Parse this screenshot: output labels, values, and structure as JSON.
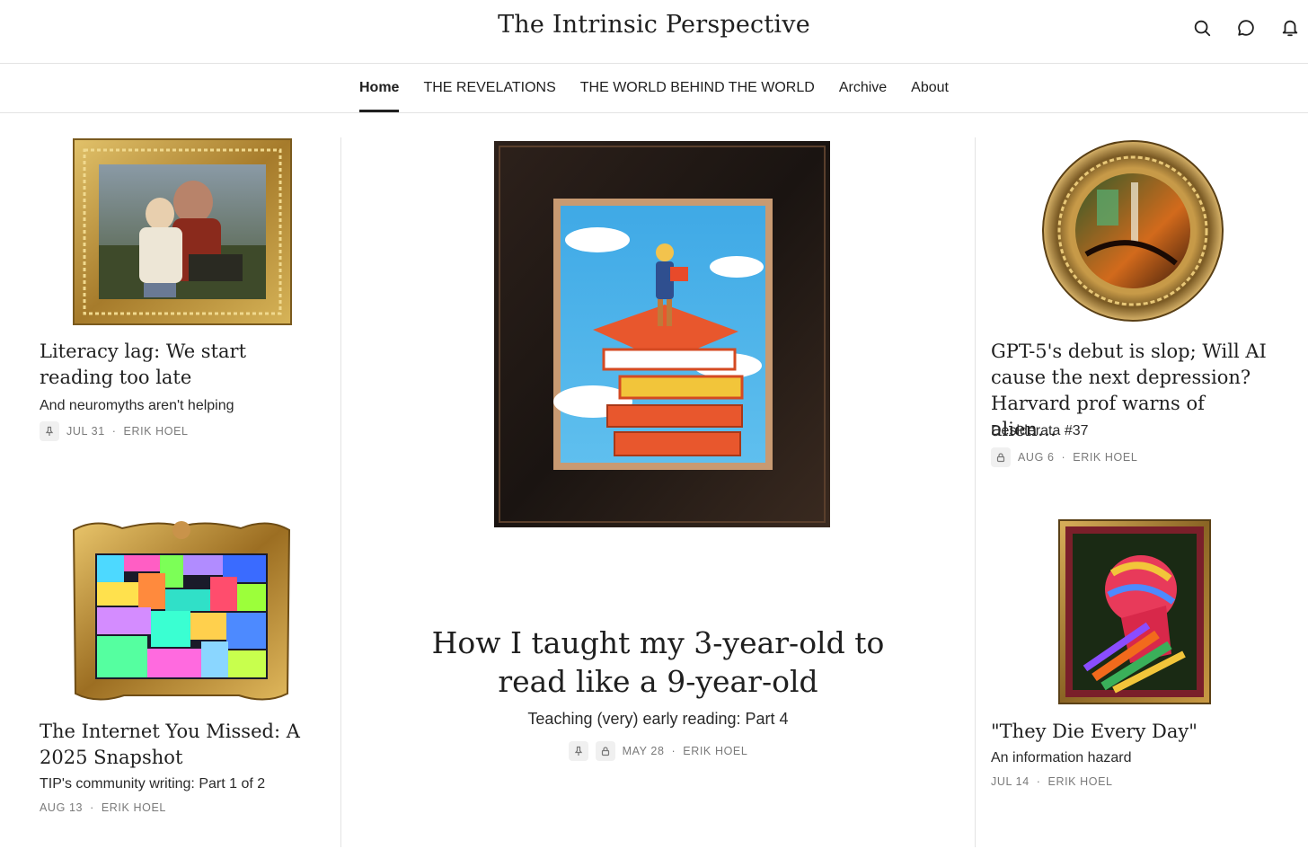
{
  "header": {
    "site_title": "The Intrinsic Perspective",
    "icons": [
      "search-icon",
      "chat-icon",
      "bell-icon"
    ]
  },
  "nav": {
    "items": [
      {
        "label": "Home",
        "active": true
      },
      {
        "label": "THE REVELATIONS",
        "active": false
      },
      {
        "label": "THE WORLD BEHIND THE WORLD",
        "active": false
      },
      {
        "label": "Archive",
        "active": false
      },
      {
        "label": "About",
        "active": false
      }
    ]
  },
  "posts": {
    "literacy": {
      "title": "Literacy lag: We start reading too late",
      "subtitle": "And neuromyths aren't helping",
      "date": "JUL 31",
      "author": "ERIK HOEL",
      "badges": [
        "pin-icon"
      ]
    },
    "internet": {
      "title": "The Internet You Missed: A 2025 Snapshot",
      "subtitle": "TIP's community writing: Part 1 of 2",
      "date": "AUG 13",
      "author": "ERIK HOEL",
      "badges": []
    },
    "featured": {
      "title": "How I taught my 3-year-old to read like a 9-year-old",
      "subtitle": "Teaching (very) early reading: Part 4",
      "date": "MAY 28",
      "author": "ERIK HOEL",
      "badges": [
        "pin-icon",
        "lock-icon"
      ]
    },
    "gpt5": {
      "title": "GPT-5's debut is slop; Will AI cause the next depression? Harvard prof warns of alien…",
      "subtitle": "Desiderata #37",
      "date": "AUG 6",
      "author": "ERIK HOEL",
      "badges": [
        "lock-icon"
      ]
    },
    "die": {
      "title": "\"They Die Every Day\"",
      "subtitle": "An information hazard",
      "date": "JUL 14",
      "author": "ERIK HOEL",
      "badges": []
    }
  },
  "meta_separator": "·",
  "colors": {
    "text": "#1f1f1f",
    "meta": "#7a7a7a",
    "divider": "#e3e3e3",
    "gold_frame": "#b8913a",
    "dark_frame": "#2a1d17"
  }
}
